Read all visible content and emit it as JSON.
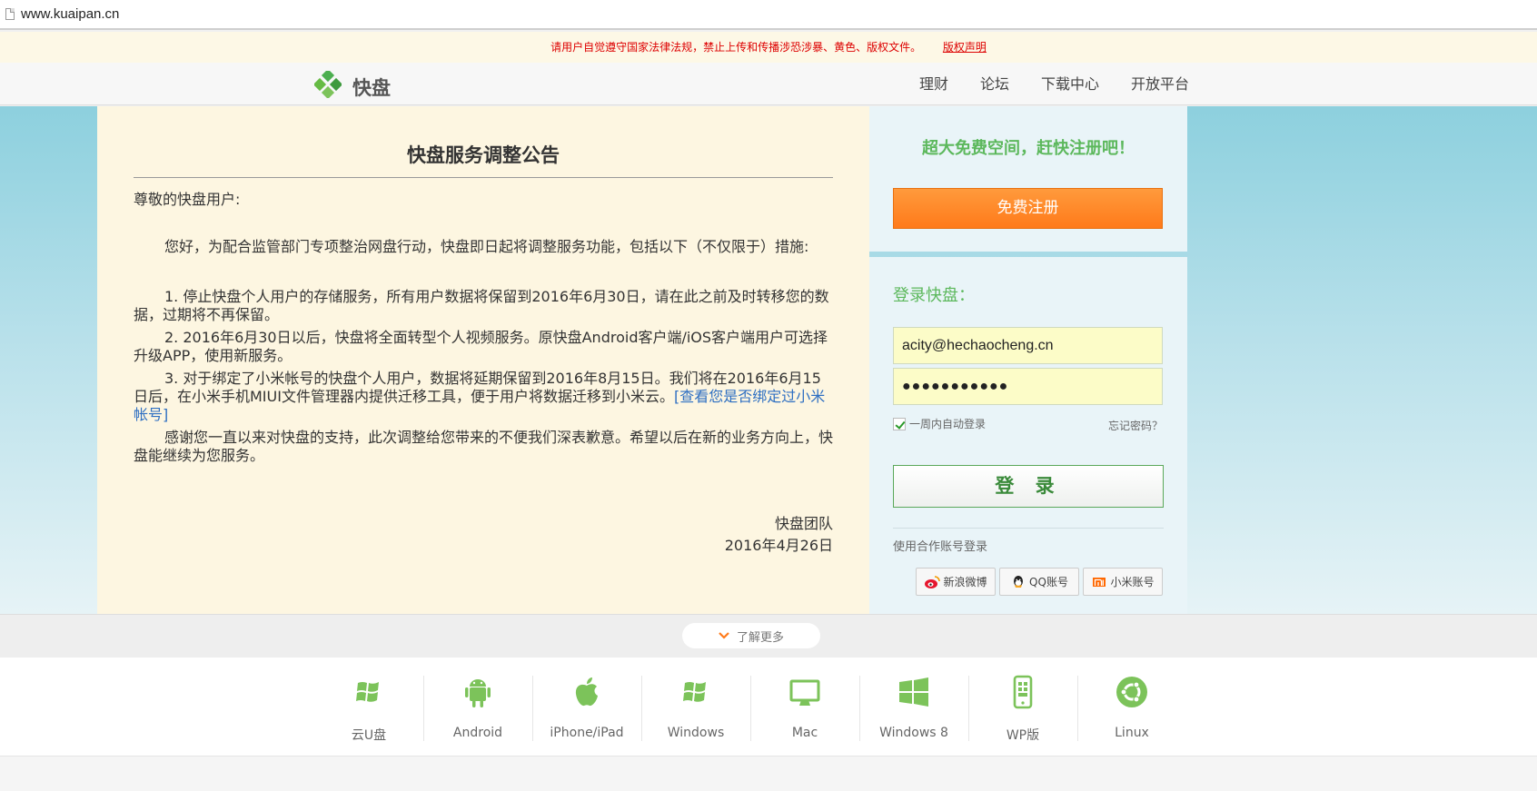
{
  "browser": {
    "url": "www.kuaipan.cn"
  },
  "notice": {
    "text": "请用户自觉遵守国家法律法规，禁止上传和传播涉恐涉暴、黄色、版权文件。",
    "link": "版权声明"
  },
  "header": {
    "logo_text": "快盘",
    "nav": [
      "理财",
      "论坛",
      "下载中心",
      "开放平台"
    ]
  },
  "announcement": {
    "title": "快盘服务调整公告",
    "greeting": "尊敬的快盘用户:",
    "intro": "您好，为配合监管部门专项整治网盘行动，快盘即日起将调整服务功能，包括以下（不仅限于）措施:",
    "item1": "1. 停止快盘个人用户的存储服务，所有用户数据将保留到2016年6月30日，请在此之前及时转移您的数据，过期将不再保留。",
    "item2": "2. 2016年6月30日以后，快盘将全面转型个人视频服务。原快盘Android客户端/iOS客户端用户可选择升级APP，使用新服务。",
    "item3": "3. 对于绑定了小米帐号的快盘个人用户，数据将延期保留到2016年8月15日。我们将在2016年6月15日后，在小米手机MIUI文件管理器内提供迁移工具，便于用户将数据迁移到小米云。",
    "item3_link": "[查看您是否绑定过小米帐号]",
    "thanks": "感谢您一直以来对快盘的支持，此次调整给您带来的不便我们深表歉意。希望以后在新的业务方向上，快盘能继续为您服务。",
    "team": "快盘团队",
    "date": "2016年4月26日"
  },
  "register": {
    "slogan": "超大免费空间，赶快注册吧！",
    "button": "免费注册"
  },
  "login": {
    "title": "登录快盘：",
    "email": "acity@hechaocheng.cn",
    "password_mask": "●●●●●●●●●●●",
    "remember": "一周内自动登录",
    "forgot": "忘记密码？",
    "button": "登 录",
    "partner_title": "使用合作账号登录",
    "partners": [
      "新浪微博",
      "QQ账号",
      "小米账号"
    ]
  },
  "more": {
    "label": "了解更多"
  },
  "platforms": [
    "云U盘",
    "Android",
    "iPhone/iPad",
    "Windows",
    "Mac",
    "Windows 8",
    "WP版",
    "Linux"
  ],
  "colors": {
    "green": "#5cb85c",
    "orange": "#ff7a1a",
    "notice_red": "#dd0000",
    "link_blue": "#2e6fc2"
  }
}
